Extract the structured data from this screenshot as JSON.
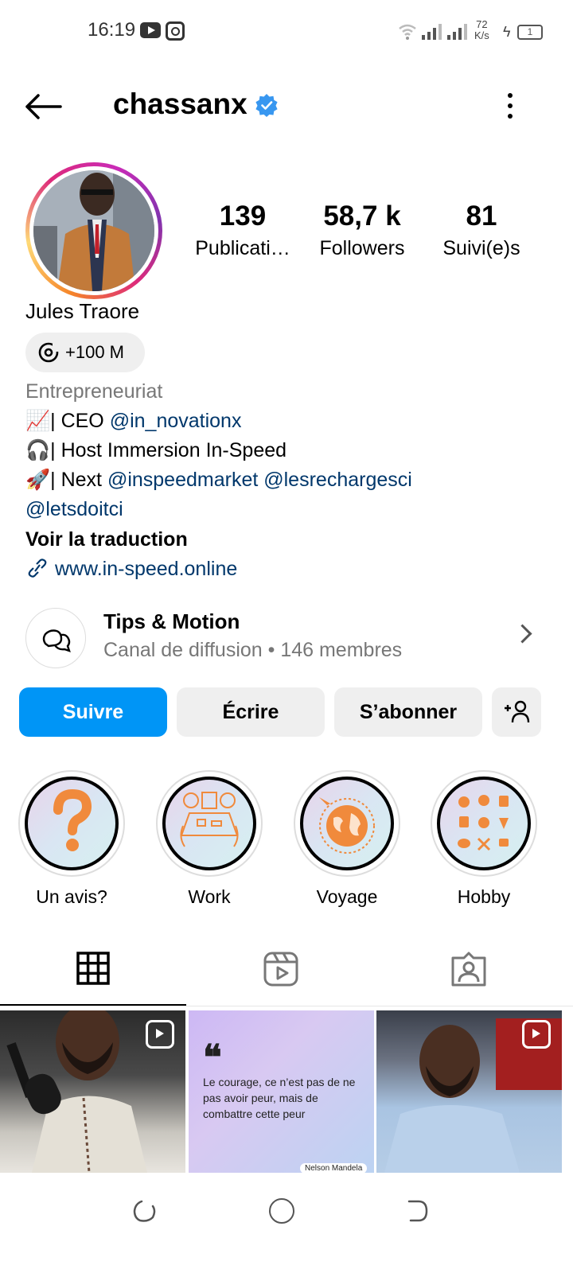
{
  "status_bar": {
    "time": "16:19",
    "speed_value": "72",
    "speed_unit": "K/s",
    "battery": "1",
    "icons": [
      "youtube-icon",
      "instagram-icon",
      "wifi-icon",
      "signal-icon",
      "charging-icon",
      "battery-icon"
    ]
  },
  "header": {
    "username": "chassanx",
    "verified": true
  },
  "profile": {
    "stats": [
      {
        "value": "139",
        "label": "Publicati…"
      },
      {
        "value": "58,7 k",
        "label": "Followers"
      },
      {
        "value": "81",
        "label": "Suivi(e)s"
      }
    ],
    "full_name": "Jules Traore",
    "threads_badge": "+100 M",
    "category": "Entrepreneuriat",
    "bio_line1_prefix": "| CEO ",
    "bio_line1_link": "@in_novationx",
    "bio_line2": "| Host Immersion In-Speed",
    "bio_line3_prefix": "| Next ",
    "bio_line3_link1": "@inspeedmarket",
    "bio_line3_link2": "@lesrechargesci",
    "bio_line4_link": "@letsdoitci",
    "translate": "Voir la traduction",
    "website": "www.in-speed.online"
  },
  "channel": {
    "title": "Tips & Motion",
    "subtitle": "Canal de diffusion • 146 membres"
  },
  "actions": {
    "follow": "Suivre",
    "message": "Écrire",
    "subscribe": "S’abonner"
  },
  "highlights": [
    {
      "label": "Un avis?"
    },
    {
      "label": "Work"
    },
    {
      "label": "Voyage"
    },
    {
      "label": "Hobby"
    }
  ],
  "posts": {
    "quote": "Le courage, ce n’est pas de ne pas avoir peur, mais de combattre cette peur",
    "quote_author": "Nelson Mandela"
  },
  "colors": {
    "accent": "#0095f6",
    "link": "#00376b",
    "verified": "#3897f0"
  }
}
